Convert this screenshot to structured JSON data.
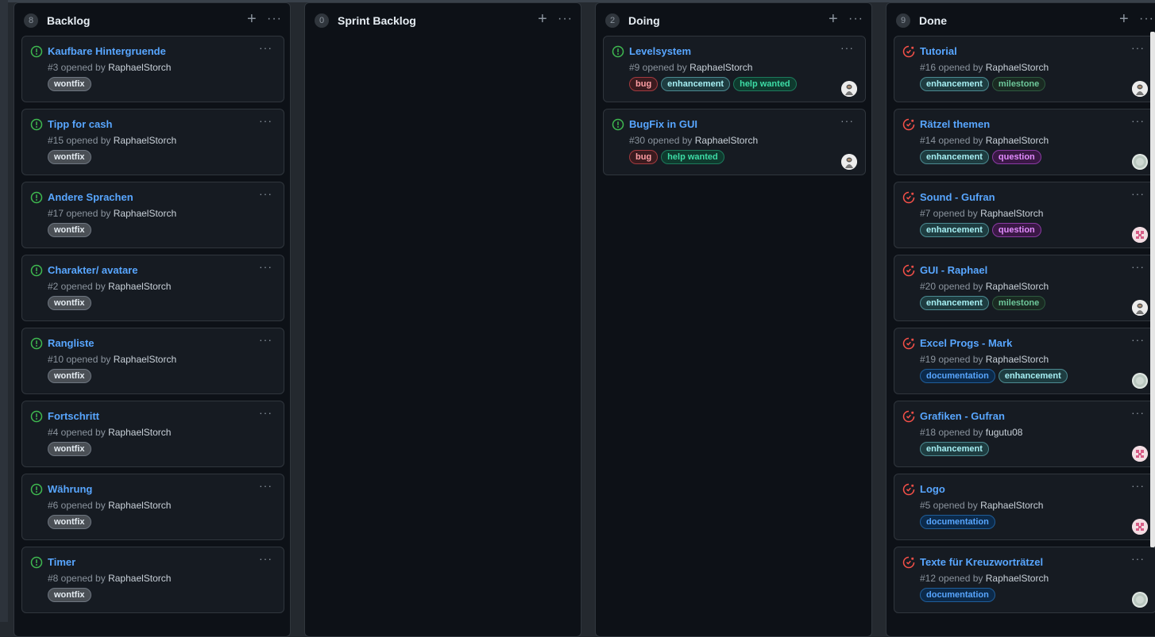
{
  "columns": [
    {
      "count": "8",
      "title": "Backlog",
      "cards": [
        {
          "title": "Kaufbare Hintergruende",
          "meta": "#3 opened by",
          "author": "RaphaelStorch",
          "labels": [
            "wontfix"
          ],
          "state": "open"
        },
        {
          "title": "Tipp for cash",
          "meta": "#15 opened by",
          "author": "RaphaelStorch",
          "labels": [
            "wontfix"
          ],
          "state": "open"
        },
        {
          "title": "Andere Sprachen",
          "meta": "#17 opened by",
          "author": "RaphaelStorch",
          "labels": [
            "wontfix"
          ],
          "state": "open"
        },
        {
          "title": "Charakter/ avatare",
          "meta": "#2 opened by",
          "author": "RaphaelStorch",
          "labels": [
            "wontfix"
          ],
          "state": "open"
        },
        {
          "title": "Rangliste",
          "meta": "#10 opened by",
          "author": "RaphaelStorch",
          "labels": [
            "wontfix"
          ],
          "state": "open"
        },
        {
          "title": "Fortschritt",
          "meta": "#4 opened by",
          "author": "RaphaelStorch",
          "labels": [
            "wontfix"
          ],
          "state": "open"
        },
        {
          "title": "Währung",
          "meta": "#6 opened by",
          "author": "RaphaelStorch",
          "labels": [
            "wontfix"
          ],
          "state": "open"
        },
        {
          "title": "Timer",
          "meta": "#8 opened by",
          "author": "RaphaelStorch",
          "labels": [
            "wontfix"
          ],
          "state": "open"
        }
      ]
    },
    {
      "count": "0",
      "title": "Sprint Backlog",
      "cards": []
    },
    {
      "count": "2",
      "title": "Doing",
      "cards": [
        {
          "title": "Levelsystem",
          "meta": "#9 opened by",
          "author": "RaphaelStorch",
          "labels": [
            "bug",
            "enhancement",
            "help wanted"
          ],
          "state": "open",
          "avatar": "a"
        },
        {
          "title": "BugFix in GUI",
          "meta": "#30 opened by",
          "author": "RaphaelStorch",
          "labels": [
            "bug",
            "help wanted"
          ],
          "state": "open",
          "avatar": "a"
        }
      ]
    },
    {
      "count": "9",
      "title": "Done",
      "cards": [
        {
          "title": "Tutorial",
          "meta": "#16 opened by",
          "author": "RaphaelStorch",
          "labels": [
            "enhancement",
            "milestone"
          ],
          "state": "closed",
          "avatar": "a"
        },
        {
          "title": "Rätzel themen",
          "meta": "#14 opened by",
          "author": "RaphaelStorch",
          "labels": [
            "enhancement",
            "question"
          ],
          "state": "closed",
          "avatar": "b"
        },
        {
          "title": "Sound - Gufran",
          "meta": "#7 opened by",
          "author": "RaphaelStorch",
          "labels": [
            "enhancement",
            "question"
          ],
          "state": "closed",
          "avatar": "c"
        },
        {
          "title": "GUI - Raphael",
          "meta": "#20 opened by",
          "author": "RaphaelStorch",
          "labels": [
            "enhancement",
            "milestone"
          ],
          "state": "closed",
          "avatar": "a"
        },
        {
          "title": "Excel Progs - Mark",
          "meta": "#19 opened by",
          "author": "RaphaelStorch",
          "labels": [
            "documentation",
            "enhancement"
          ],
          "state": "closed",
          "avatar": "b"
        },
        {
          "title": "Grafiken - Gufran",
          "meta": "#18 opened by",
          "author": "fugutu08",
          "labels": [
            "enhancement"
          ],
          "state": "closed",
          "avatar": "c"
        },
        {
          "title": "Logo",
          "meta": "#5 opened by",
          "author": "RaphaelStorch",
          "labels": [
            "documentation"
          ],
          "state": "closed",
          "avatar": "c"
        },
        {
          "title": "Texte für Kreuzworträtzel",
          "meta": "#12 opened by",
          "author": "RaphaelStorch",
          "labels": [
            "documentation"
          ],
          "state": "closed",
          "avatar": "b"
        }
      ]
    }
  ],
  "icons": {
    "add": "+",
    "more": "···"
  },
  "colors": {
    "open": "#3fb950",
    "closed": "#f85149",
    "link": "#58a6ff"
  }
}
